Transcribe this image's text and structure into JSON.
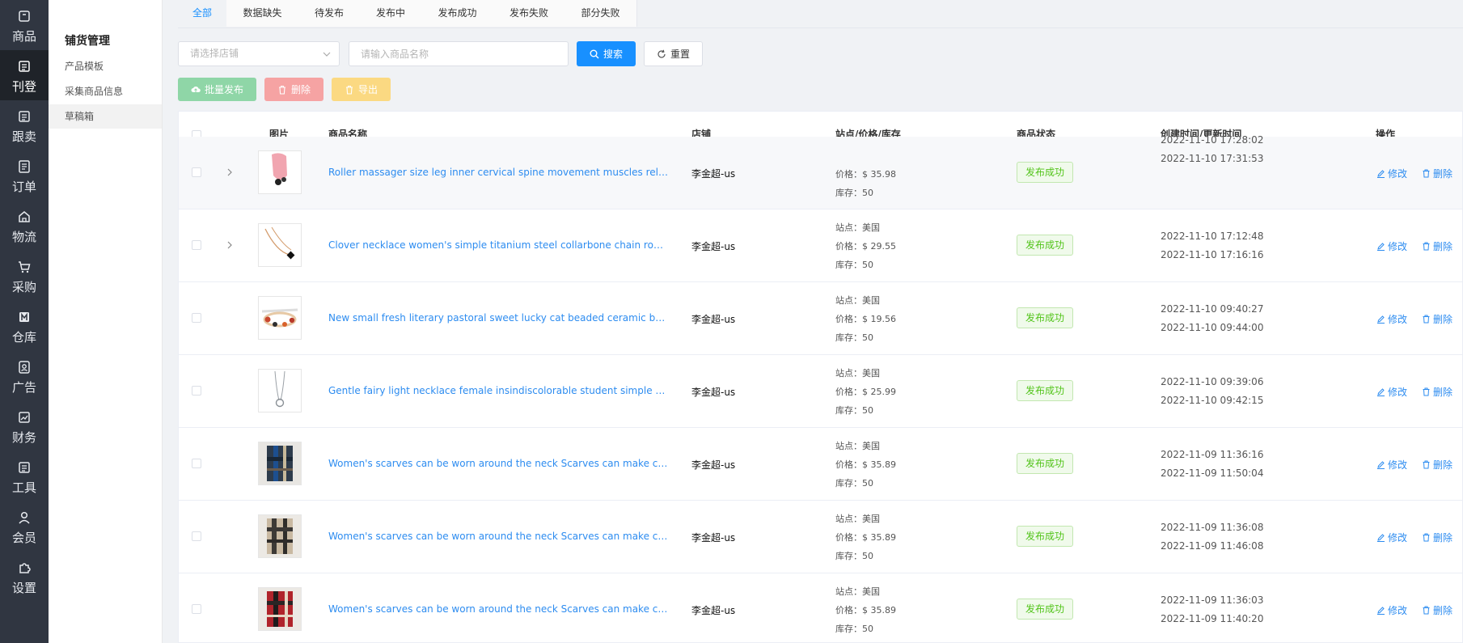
{
  "rail": [
    {
      "label": "商品",
      "icon": "package-icon"
    },
    {
      "label": "刊登",
      "icon": "document-icon",
      "active": true
    },
    {
      "label": "跟卖",
      "icon": "document-icon"
    },
    {
      "label": "订单",
      "icon": "list-icon"
    },
    {
      "label": "物流",
      "icon": "home-icon"
    },
    {
      "label": "采购",
      "icon": "cart-icon"
    },
    {
      "label": "仓库",
      "icon": "warehouse-icon"
    },
    {
      "label": "广告",
      "icon": "ad-icon"
    },
    {
      "label": "财务",
      "icon": "finance-icon"
    },
    {
      "label": "工具",
      "icon": "tool-icon"
    },
    {
      "label": "会员",
      "icon": "user-icon"
    },
    {
      "label": "设置",
      "icon": "puzzle-icon"
    }
  ],
  "submenu": {
    "title": "铺货管理",
    "items": [
      "产品模板",
      "采集商品信息",
      "草稿箱"
    ],
    "active_index": 2
  },
  "tabs": [
    {
      "label": "全部",
      "active": true
    },
    {
      "label": "数据缺失"
    },
    {
      "label": "待发布"
    },
    {
      "label": "发布中"
    },
    {
      "label": "发布成功"
    },
    {
      "label": "发布失败"
    },
    {
      "label": "部分失败"
    }
  ],
  "filters": {
    "store_placeholder": "请选择店铺",
    "name_placeholder": "请输入商品名称",
    "search_label": "搜索",
    "reset_label": "重置"
  },
  "actions": {
    "publish_label": "批量发布",
    "delete_label": "删除",
    "export_label": "导出"
  },
  "table": {
    "columns": [
      "图片",
      "商品名称",
      "店铺",
      "站点/价格/库存",
      "商品状态",
      "创建时间/更新时间",
      "操作"
    ],
    "edit_label": "修改",
    "delete_label": "删除",
    "rows": [
      {
        "name": "Roller massager size leg inner cervical spine movement muscles relax ab...",
        "store": "李金超-us",
        "site": "",
        "price": "价格：$ 35.98",
        "stock": "库存：50",
        "status": "发布成功",
        "created": "2022-11-10 17:28:02",
        "updated": "2022-11-10 17:31:53",
        "expandable": true,
        "thumb": "massager"
      },
      {
        "name": "Clover necklace women's simple titanium steel collarbone chain rose gol...",
        "store": "李金超-us",
        "site": "站点：美国",
        "price": "价格：$ 29.55",
        "stock": "库存：50",
        "status": "发布成功",
        "created": "2022-11-10 17:12:48",
        "updated": "2022-11-10 17:16:16",
        "expandable": true,
        "thumb": "necklace-gold"
      },
      {
        "name": "New small fresh literary pastoral sweet lucky cat beaded ceramic bracele...",
        "store": "李金超-us",
        "site": "站点：美国",
        "price": "价格：$ 19.56",
        "stock": "库存：50",
        "status": "发布成功",
        "created": "2022-11-10 09:40:27",
        "updated": "2022-11-10 09:44:00",
        "expandable": false,
        "thumb": "bracelet"
      },
      {
        "name": "Gentle fairy light necklace female insindiscolorable student simple send ...",
        "store": "李金超-us",
        "site": "站点：美国",
        "price": "价格：$ 25.99",
        "stock": "库存：50",
        "status": "发布成功",
        "created": "2022-11-10 09:39:06",
        "updated": "2022-11-10 09:42:15",
        "expandable": false,
        "thumb": "necklace-silver"
      },
      {
        "name": "Women's scarves can be worn around the neck Scarves can make cold w...",
        "store": "李金超-us",
        "site": "站点：美国",
        "price": "价格：$ 35.89",
        "stock": "库存：50",
        "status": "发布成功",
        "created": "2022-11-09 11:36:16",
        "updated": "2022-11-09 11:50:04",
        "expandable": false,
        "thumb": "scarf-blue"
      },
      {
        "name": "Women's scarves can be worn around the neck Scarves can make cold w...",
        "store": "李金超-us",
        "site": "站点：美国",
        "price": "价格：$ 35.89",
        "stock": "库存：50",
        "status": "发布成功",
        "created": "2022-11-09 11:36:08",
        "updated": "2022-11-09 11:46:08",
        "expandable": false,
        "thumb": "scarf-beige"
      },
      {
        "name": "Women's scarves can be worn around the neck Scarves can make cold w...",
        "store": "李金超-us",
        "site": "站点：美国",
        "price": "价格：$ 35.89",
        "stock": "库存：50",
        "status": "发布成功",
        "created": "2022-11-09 11:36:03",
        "updated": "2022-11-09 11:40:20",
        "expandable": false,
        "thumb": "scarf-red"
      }
    ]
  },
  "colors": {
    "primary": "#1890ff",
    "rail_bg": "#303641",
    "rail_active": "#1f2329",
    "success": "#52c41a",
    "publish_btn": "#8fd6a7",
    "delete_btn": "#f6a3a3",
    "export_btn": "#fbd982"
  }
}
